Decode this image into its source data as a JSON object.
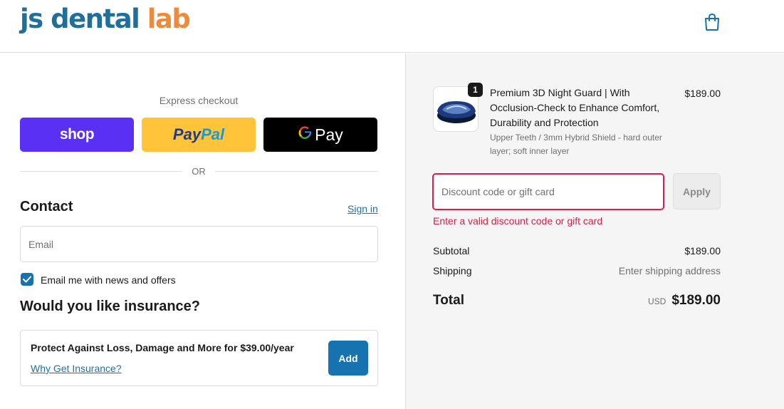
{
  "header": {
    "logo_part1": "js dental ",
    "logo_part2": "lab",
    "logo_color1": "#1f6f9a",
    "logo_color2": "#ee8a3c",
    "cart_icon": "shopping-bag-icon"
  },
  "express": {
    "title": "Express checkout",
    "shop_label": "shop",
    "paypal_part1": "Pay",
    "paypal_part2": "Pal",
    "gpay_g": "G",
    "gpay_label": "Pay",
    "or_label": "OR"
  },
  "contact": {
    "title": "Contact",
    "signin_label": "Sign in",
    "email_placeholder": "Email",
    "email_value": "",
    "newsletter_label": "Email me with news and offers",
    "newsletter_checked": true
  },
  "insurance": {
    "title": "Would you like insurance?",
    "offer_text": "Protect Against Loss, Damage and More for $39.00/year",
    "link_label": "Why Get Insurance?",
    "add_label": "Add"
  },
  "order": {
    "product": {
      "quantity": "1",
      "title": "Premium 3D Night Guard | With Occlusion-Check to Enhance Comfort, Durability and Protection",
      "variant": "Upper Teeth / 3mm Hybrid Shield - hard outer layer; soft inner layer",
      "price": "$189.00"
    },
    "discount": {
      "placeholder": "Discount code or gift card",
      "value": "",
      "apply_label": "Apply",
      "error": "Enter a valid discount code or gift card"
    },
    "summary": {
      "subtotal_label": "Subtotal",
      "subtotal_value": "$189.00",
      "shipping_label": "Shipping",
      "shipping_value": "Enter shipping address",
      "total_label": "Total",
      "total_currency": "USD",
      "total_value": "$189.00"
    }
  },
  "colors": {
    "accent": "#1773b0",
    "error": "#dd1d4a",
    "shop_purple": "#5a31f4",
    "paypal_yellow": "#ffc439",
    "gpay_black": "#000000"
  }
}
